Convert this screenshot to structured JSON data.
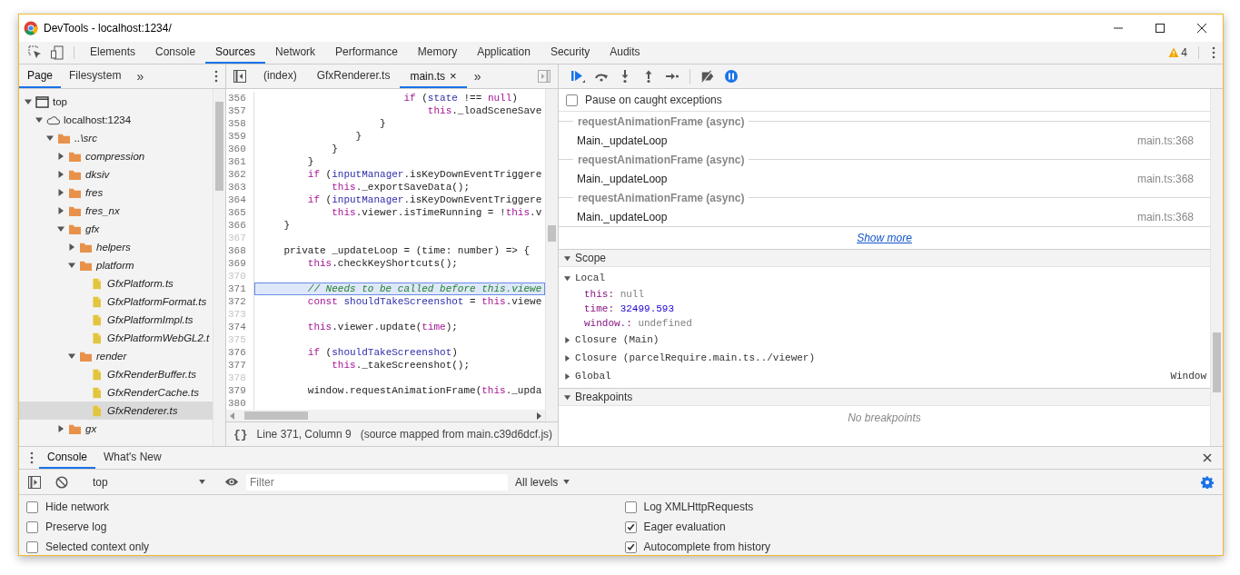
{
  "window": {
    "title": "DevTools - localhost:1234/"
  },
  "main_tabs": [
    {
      "label": "Elements",
      "selected": false
    },
    {
      "label": "Console",
      "selected": false
    },
    {
      "label": "Sources",
      "selected": true
    },
    {
      "label": "Network",
      "selected": false
    },
    {
      "label": "Performance",
      "selected": false
    },
    {
      "label": "Memory",
      "selected": false
    },
    {
      "label": "Application",
      "selected": false
    },
    {
      "label": "Security",
      "selected": false
    },
    {
      "label": "Audits",
      "selected": false
    }
  ],
  "warnings": {
    "count": "4"
  },
  "navigator": {
    "tabs": [
      {
        "label": "Page",
        "selected": true
      },
      {
        "label": "Filesystem",
        "selected": false
      }
    ],
    "more": "»",
    "tree": [
      {
        "label": "top",
        "kind": "frame",
        "expanded": true,
        "selected": false,
        "children": [
          {
            "label": "localhost:1234",
            "kind": "domain",
            "expanded": true,
            "selected": false,
            "children": [
              {
                "label": "..\\src",
                "kind": "folder",
                "expanded": true,
                "selected": false,
                "children": [
                  {
                    "label": "compression",
                    "kind": "folder",
                    "expanded": false,
                    "selected": false
                  },
                  {
                    "label": "dksiv",
                    "kind": "folder",
                    "expanded": false,
                    "selected": false
                  },
                  {
                    "label": "fres",
                    "kind": "folder",
                    "expanded": false,
                    "selected": false
                  },
                  {
                    "label": "fres_nx",
                    "kind": "folder",
                    "expanded": false,
                    "selected": false
                  },
                  {
                    "label": "gfx",
                    "kind": "folder",
                    "expanded": true,
                    "selected": false,
                    "children": [
                      {
                        "label": "helpers",
                        "kind": "folder",
                        "expanded": false,
                        "selected": false
                      },
                      {
                        "label": "platform",
                        "kind": "folder",
                        "expanded": true,
                        "selected": false,
                        "children": [
                          {
                            "label": "GfxPlatform.ts",
                            "kind": "file",
                            "selected": false
                          },
                          {
                            "label": "GfxPlatformFormat.ts",
                            "kind": "file",
                            "selected": false
                          },
                          {
                            "label": "GfxPlatformImpl.ts",
                            "kind": "file",
                            "selected": false
                          },
                          {
                            "label": "GfxPlatformWebGL2.t",
                            "kind": "file",
                            "selected": false
                          }
                        ]
                      },
                      {
                        "label": "render",
                        "kind": "folder",
                        "expanded": true,
                        "selected": false,
                        "children": [
                          {
                            "label": "GfxRenderBuffer.ts",
                            "kind": "file",
                            "selected": false
                          },
                          {
                            "label": "GfxRenderCache.ts",
                            "kind": "file",
                            "selected": false
                          },
                          {
                            "label": "GfxRenderer.ts",
                            "kind": "file",
                            "selected": true
                          }
                        ]
                      }
                    ]
                  },
                  {
                    "label": "gx",
                    "kind": "folder",
                    "expanded": false,
                    "selected": false
                  }
                ]
              }
            ]
          }
        ]
      }
    ]
  },
  "editor": {
    "tabs": [
      {
        "label": "(index)",
        "selected": false
      },
      {
        "label": "GfxRenderer.ts",
        "selected": false
      },
      {
        "label": "main.ts",
        "selected": true,
        "close": "×"
      }
    ],
    "more": "»",
    "lines": [
      {
        "number": "356",
        "breakable": true,
        "current": false,
        "tokens": [
          {
            "text": "                        if",
            "kind": "keyword"
          },
          {
            "text": " (",
            "kind": "plain"
          },
          {
            "text": "state",
            "kind": "variable"
          },
          {
            "text": " !== ",
            "kind": "plain"
          },
          {
            "text": "null",
            "kind": "keyword"
          },
          {
            "text": ")",
            "kind": "plain"
          }
        ]
      },
      {
        "number": "357",
        "breakable": true,
        "current": false,
        "tokens": [
          {
            "text": "                            this",
            "kind": "keyword"
          },
          {
            "text": "._loadSceneSave",
            "kind": "plain"
          }
        ]
      },
      {
        "number": "358",
        "breakable": true,
        "current": false,
        "tokens": [
          {
            "text": "                    }",
            "kind": "plain"
          }
        ]
      },
      {
        "number": "359",
        "breakable": true,
        "current": false,
        "tokens": [
          {
            "text": "                }",
            "kind": "plain"
          }
        ]
      },
      {
        "number": "360",
        "breakable": true,
        "current": false,
        "tokens": [
          {
            "text": "            }",
            "kind": "plain"
          }
        ]
      },
      {
        "number": "361",
        "breakable": true,
        "current": false,
        "tokens": [
          {
            "text": "        }",
            "kind": "plain"
          }
        ]
      },
      {
        "number": "362",
        "breakable": true,
        "current": false,
        "tokens": [
          {
            "text": "        if",
            "kind": "keyword"
          },
          {
            "text": " (",
            "kind": "plain"
          },
          {
            "text": "inputManager",
            "kind": "variable"
          },
          {
            "text": ".isKeyDownEventTriggere",
            "kind": "plain"
          }
        ]
      },
      {
        "number": "363",
        "breakable": true,
        "current": false,
        "tokens": [
          {
            "text": "            this",
            "kind": "keyword"
          },
          {
            "text": "._exportSaveData();",
            "kind": "plain"
          }
        ]
      },
      {
        "number": "364",
        "breakable": true,
        "current": false,
        "tokens": [
          {
            "text": "        if",
            "kind": "keyword"
          },
          {
            "text": " (",
            "kind": "plain"
          },
          {
            "text": "inputManager",
            "kind": "variable"
          },
          {
            "text": ".isKeyDownEventTriggere",
            "kind": "plain"
          }
        ]
      },
      {
        "number": "365",
        "breakable": true,
        "current": false,
        "tokens": [
          {
            "text": "            this",
            "kind": "keyword"
          },
          {
            "text": ".viewer.isTimeRunning = !",
            "kind": "plain"
          },
          {
            "text": "this",
            "kind": "keyword"
          },
          {
            "text": ".v",
            "kind": "plain"
          }
        ]
      },
      {
        "number": "366",
        "breakable": true,
        "current": false,
        "tokens": [
          {
            "text": "    }",
            "kind": "plain"
          }
        ]
      },
      {
        "number": "367",
        "breakable": false,
        "current": false
      },
      {
        "number": "368",
        "breakable": true,
        "current": false,
        "tokens": [
          {
            "text": "    private _updateLoop = (time: number) => {",
            "kind": "plain"
          }
        ]
      },
      {
        "number": "369",
        "breakable": true,
        "current": false,
        "tokens": [
          {
            "text": "        this",
            "kind": "keyword"
          },
          {
            "text": ".checkKeyShortcuts();",
            "kind": "plain"
          }
        ]
      },
      {
        "number": "370",
        "breakable": false,
        "current": false
      },
      {
        "number": "371",
        "breakable": true,
        "current": true,
        "tokens": [
          {
            "text": "        // Needs to be called before this.viewe",
            "kind": "comment"
          }
        ]
      },
      {
        "number": "372",
        "breakable": true,
        "current": false,
        "tokens": [
          {
            "text": "        const",
            "kind": "keyword"
          },
          {
            "text": " shouldTakeScreenshot",
            "kind": "variable"
          },
          {
            "text": " = ",
            "kind": "plain"
          },
          {
            "text": "this",
            "kind": "keyword"
          },
          {
            "text": ".viewe",
            "kind": "plain"
          }
        ]
      },
      {
        "number": "373",
        "breakable": false,
        "current": false
      },
      {
        "number": "374",
        "breakable": true,
        "current": false,
        "tokens": [
          {
            "text": "        this",
            "kind": "keyword"
          },
          {
            "text": ".viewer.update(",
            "kind": "plain"
          },
          {
            "text": "time",
            "kind": "keyword"
          },
          {
            "text": ");",
            "kind": "plain"
          }
        ]
      },
      {
        "number": "375",
        "breakable": false,
        "current": false
      },
      {
        "number": "376",
        "breakable": true,
        "current": false,
        "tokens": [
          {
            "text": "        if",
            "kind": "keyword"
          },
          {
            "text": " (",
            "kind": "plain"
          },
          {
            "text": "shouldTakeScreenshot",
            "kind": "variable"
          },
          {
            "text": ")",
            "kind": "plain"
          }
        ]
      },
      {
        "number": "377",
        "breakable": true,
        "current": false,
        "tokens": [
          {
            "text": "            this",
            "kind": "keyword"
          },
          {
            "text": "._takeScreenshot();",
            "kind": "plain"
          }
        ]
      },
      {
        "number": "378",
        "breakable": false,
        "current": false
      },
      {
        "number": "379",
        "breakable": true,
        "current": false,
        "tokens": [
          {
            "text": "        window.requestAnimationFrame(",
            "kind": "plain"
          },
          {
            "text": "this",
            "kind": "keyword"
          },
          {
            "text": "._upda",
            "kind": "plain"
          }
        ]
      },
      {
        "number": "380",
        "breakable": true,
        "current": false
      }
    ],
    "format_button": "{}",
    "position": "Line 371, Column 9",
    "source_map": "(source mapped from main.c39d6dcf.js)"
  },
  "debugger": {
    "pause_on_caught": {
      "label": "Pause on caught exceptions",
      "checked": false
    },
    "call_stack": [
      {
        "kind": "async",
        "label": "requestAnimationFrame (async)"
      },
      {
        "kind": "frame",
        "name": "Main._updateLoop",
        "location": "main.ts:368"
      },
      {
        "kind": "async",
        "label": "requestAnimationFrame (async)"
      },
      {
        "kind": "frame",
        "name": "Main._updateLoop",
        "location": "main.ts:368"
      },
      {
        "kind": "async",
        "label": "requestAnimationFrame (async)"
      },
      {
        "kind": "frame",
        "name": "Main._updateLoop",
        "location": "main.ts:368"
      }
    ],
    "show_more": "Show more",
    "scope": {
      "title": "Scope",
      "expanded": true,
      "groups": [
        {
          "label": "Local",
          "expanded": true,
          "props": [
            {
              "name": "this:",
              "value": "null",
              "kind": "null"
            },
            {
              "name": "time:",
              "value": "32499.593",
              "kind": "number"
            },
            {
              "name": "window.:",
              "value": "undefined",
              "kind": "null"
            }
          ]
        },
        {
          "label": "Closure (Main)",
          "expanded": false
        },
        {
          "label": "Closure (parcelRequire.main.ts../viewer)",
          "expanded": false
        },
        {
          "label": "Global",
          "expanded": false,
          "value": "Window"
        }
      ]
    },
    "breakpoints": {
      "title": "Breakpoints",
      "expanded": true,
      "empty_text": "No breakpoints"
    }
  },
  "drawer": {
    "tabs": [
      {
        "label": "Console",
        "selected": true
      },
      {
        "label": "What's New",
        "selected": false
      }
    ],
    "context": "top",
    "filter": {
      "placeholder": "Filter"
    },
    "levels": "All levels",
    "settings_left": [
      {
        "label": "Hide network",
        "checked": false
      },
      {
        "label": "Preserve log",
        "checked": false
      },
      {
        "label": "Selected context only",
        "checked": false
      }
    ],
    "settings_right": [
      {
        "label": "Log XMLHttpRequests",
        "checked": false
      },
      {
        "label": "Eager evaluation",
        "checked": true
      },
      {
        "label": "Autocomplete from history",
        "checked": true
      }
    ]
  }
}
